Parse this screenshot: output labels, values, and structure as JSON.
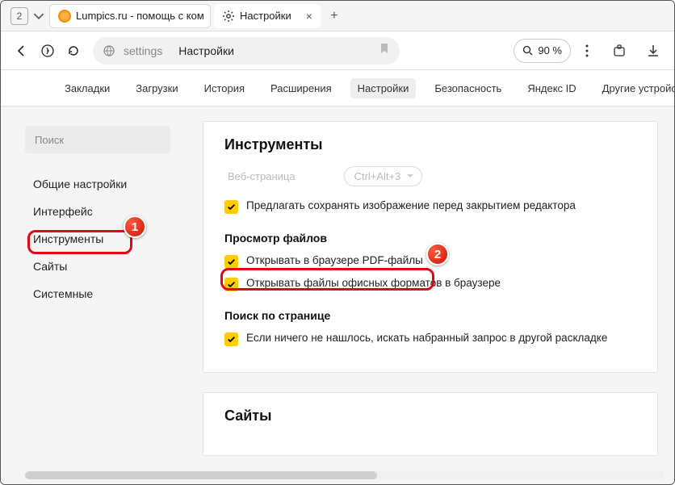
{
  "titlebar": {
    "tab_count": "2",
    "tab1_label": "Lumpics.ru - помощь с ком",
    "tab2_label": "Настройки"
  },
  "addrbar": {
    "url_text": "settings",
    "page_title": "Настройки",
    "zoom_label": "90 %"
  },
  "toptabs": {
    "items": [
      {
        "label": "Закладки"
      },
      {
        "label": "Загрузки"
      },
      {
        "label": "История"
      },
      {
        "label": "Расширения"
      },
      {
        "label": "Настройки"
      },
      {
        "label": "Безопасность"
      },
      {
        "label": "Яндекс ID"
      },
      {
        "label": "Другие устройства"
      }
    ]
  },
  "sidebar": {
    "search_placeholder": "Поиск",
    "items": [
      {
        "label": "Общие настройки"
      },
      {
        "label": "Интерфейс"
      },
      {
        "label": "Инструменты"
      },
      {
        "label": "Сайты"
      },
      {
        "label": "Системные"
      }
    ]
  },
  "content": {
    "tools_heading": "Инструменты",
    "disabled_label": "Веб-страница",
    "disabled_shortcut": "Ctrl+Alt+3",
    "opt_save_image": "Предлагать сохранять изображение перед закрытием редактора",
    "view_files_heading": "Просмотр файлов",
    "opt_pdf": "Открывать в браузере PDF-файлы",
    "opt_office": "Открывать файлы офисных форматов в браузере",
    "page_search_heading": "Поиск по странице",
    "opt_layout": "Если ничего не нашлось, искать набранный запрос в другой раскладке",
    "sites_heading": "Сайты"
  },
  "callouts": {
    "one": "1",
    "two": "2"
  }
}
